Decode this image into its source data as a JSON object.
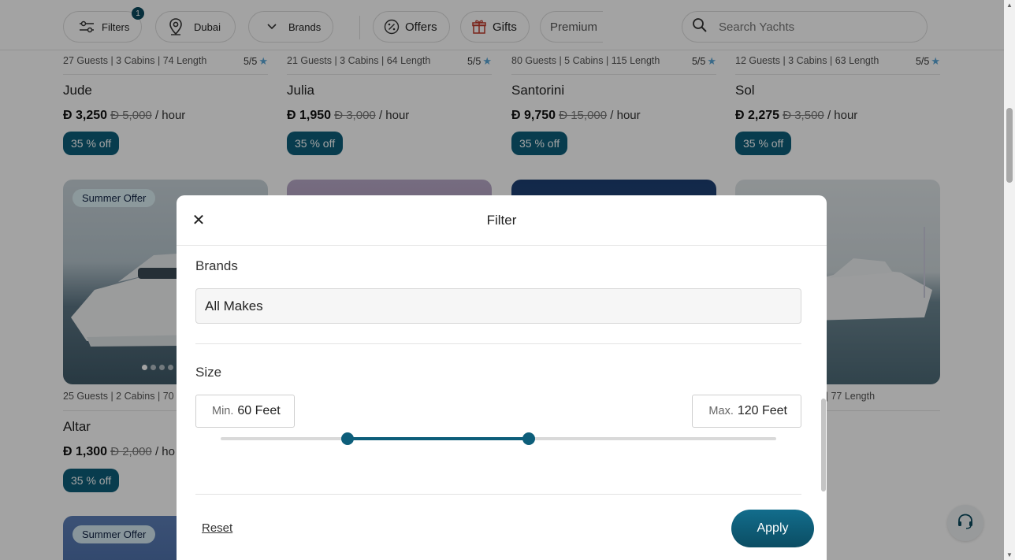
{
  "toolbar": {
    "filters_label": "Filters",
    "filters_badge": "1",
    "location_label": "Dubai",
    "brands_label": "Brands",
    "offers_label": "Offers",
    "gifts_label": "Gifts",
    "premium_label": "Premium",
    "search_placeholder": "Search Yachts"
  },
  "listings_row1": [
    {
      "meta": "27 Guests | 3 Cabins | 74 Length",
      "rating": "5/5",
      "name": "Jude",
      "price": "Đ 3,250",
      "old_price": "Đ 5,000",
      "unit": "/ hour",
      "discount": "35 % off"
    },
    {
      "meta": "21 Guests | 3 Cabins | 64 Length",
      "rating": "5/5",
      "name": "Julia",
      "price": "Đ 1,950",
      "old_price": "Đ 3,000",
      "unit": "/ hour",
      "discount": "35 % off"
    },
    {
      "meta": "80 Guests | 5 Cabins | 115 Length",
      "rating": "5/5",
      "name": "Santorini",
      "price": "Đ 9,750",
      "old_price": "Đ 15,000",
      "unit": "/ hour",
      "discount": "35 % off"
    },
    {
      "meta": "12 Guests | 3 Cabins | 63 Length",
      "rating": "5/5",
      "name": "Sol",
      "price": "Đ 2,275",
      "old_price": "Đ 3,500",
      "unit": "/ hour",
      "discount": "35 % off"
    }
  ],
  "listings_row2": [
    {
      "tag": "Summer Offer",
      "meta": "25 Guests | 2 Cabins | 70",
      "name": "Altar",
      "price": "Đ 1,300",
      "old_price": "Đ 2,000",
      "unit": "/ ho",
      "discount": "35 % off"
    },
    {
      "meta": "s | 77 Length"
    }
  ],
  "listings_row3": [
    {
      "tag": "Summer Offer"
    }
  ],
  "modal": {
    "title": "Filter",
    "brands_label": "Brands",
    "brands_value": "All Makes",
    "size_label": "Size",
    "min_label": "Min.",
    "min_value": "60 Feet",
    "max_label": "Max.",
    "max_value": "120 Feet",
    "slider": {
      "min_fraction": 0.228,
      "max_fraction": 0.555
    },
    "reset_label": "Reset",
    "apply_label": "Apply"
  },
  "colors": {
    "accent": "#0d5e7a",
    "star": "#5aa6d6"
  },
  "icons": {
    "filters": "sliders-icon",
    "location": "map-pin-icon",
    "brands": "chevron-down-icon",
    "offers": "percent-icon",
    "gifts": "gift-icon",
    "search": "search-icon",
    "close": "close-icon",
    "support": "headset-icon"
  }
}
